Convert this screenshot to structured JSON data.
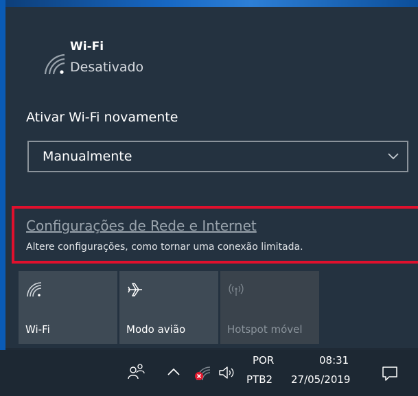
{
  "wifi": {
    "name": "Wi-Fi",
    "status": "Desativado"
  },
  "reactivate": {
    "label": "Ativar Wi-Fi novamente",
    "dropdown_value": "Manualmente"
  },
  "settings": {
    "link_text": "Configurações de Rede e Internet",
    "description": "Altere configurações, como tornar uma conexão limitada."
  },
  "tiles": [
    {
      "label": "Wi-Fi",
      "icon": "wifi-icon",
      "enabled": true
    },
    {
      "label": "Modo avião",
      "icon": "airplane-icon",
      "enabled": true
    },
    {
      "label": "Hotspot móvel",
      "icon": "hotspot-icon",
      "enabled": false
    }
  ],
  "taskbar": {
    "language_top": "POR",
    "language_bottom": "PTB2",
    "time": "08:31",
    "date": "27/05/2019"
  },
  "colors": {
    "flyout_bg": "#243240",
    "highlight_border": "#e0102d",
    "error_badge": "#e3192f"
  }
}
